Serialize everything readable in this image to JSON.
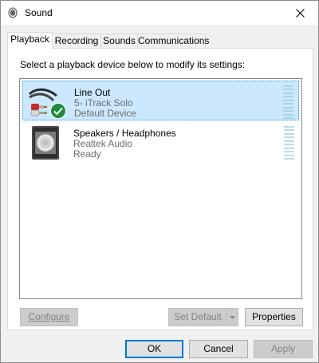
{
  "window": {
    "title": "Sound",
    "icon": "speaker-icon",
    "close_icon": "close-icon"
  },
  "tabs": [
    {
      "label": "Playback",
      "active": true
    },
    {
      "label": "Recording",
      "active": false
    },
    {
      "label": "Sounds",
      "active": false
    },
    {
      "label": "Communications",
      "active": false
    }
  ],
  "panel": {
    "instruction": "Select a playback device below to modify its settings:"
  },
  "devices": [
    {
      "name": "Line Out",
      "subtitle": "5- iTrack Solo",
      "status": "Default Device",
      "icon": "line-out-cable-icon",
      "badge": "default-checkmark-icon",
      "selected": true
    },
    {
      "name": "Speakers / Headphones",
      "subtitle": "Realtek Audio",
      "status": "Ready",
      "icon": "speaker-box-icon",
      "selected": false
    }
  ],
  "panel_buttons": {
    "configure": {
      "label": "Configure",
      "enabled": false
    },
    "set_default": {
      "label": "Set Default",
      "enabled": false
    },
    "properties": {
      "label": "Properties",
      "enabled": true
    }
  },
  "dialog_buttons": {
    "ok": {
      "label": "OK",
      "enabled": true
    },
    "cancel": {
      "label": "Cancel",
      "enabled": true
    },
    "apply": {
      "label": "Apply",
      "enabled": false
    }
  },
  "colors": {
    "selection": "#cce8ff",
    "selection_border": "#26a0da",
    "accent": "#0078d7",
    "badge_green": "#1e8a3c"
  }
}
